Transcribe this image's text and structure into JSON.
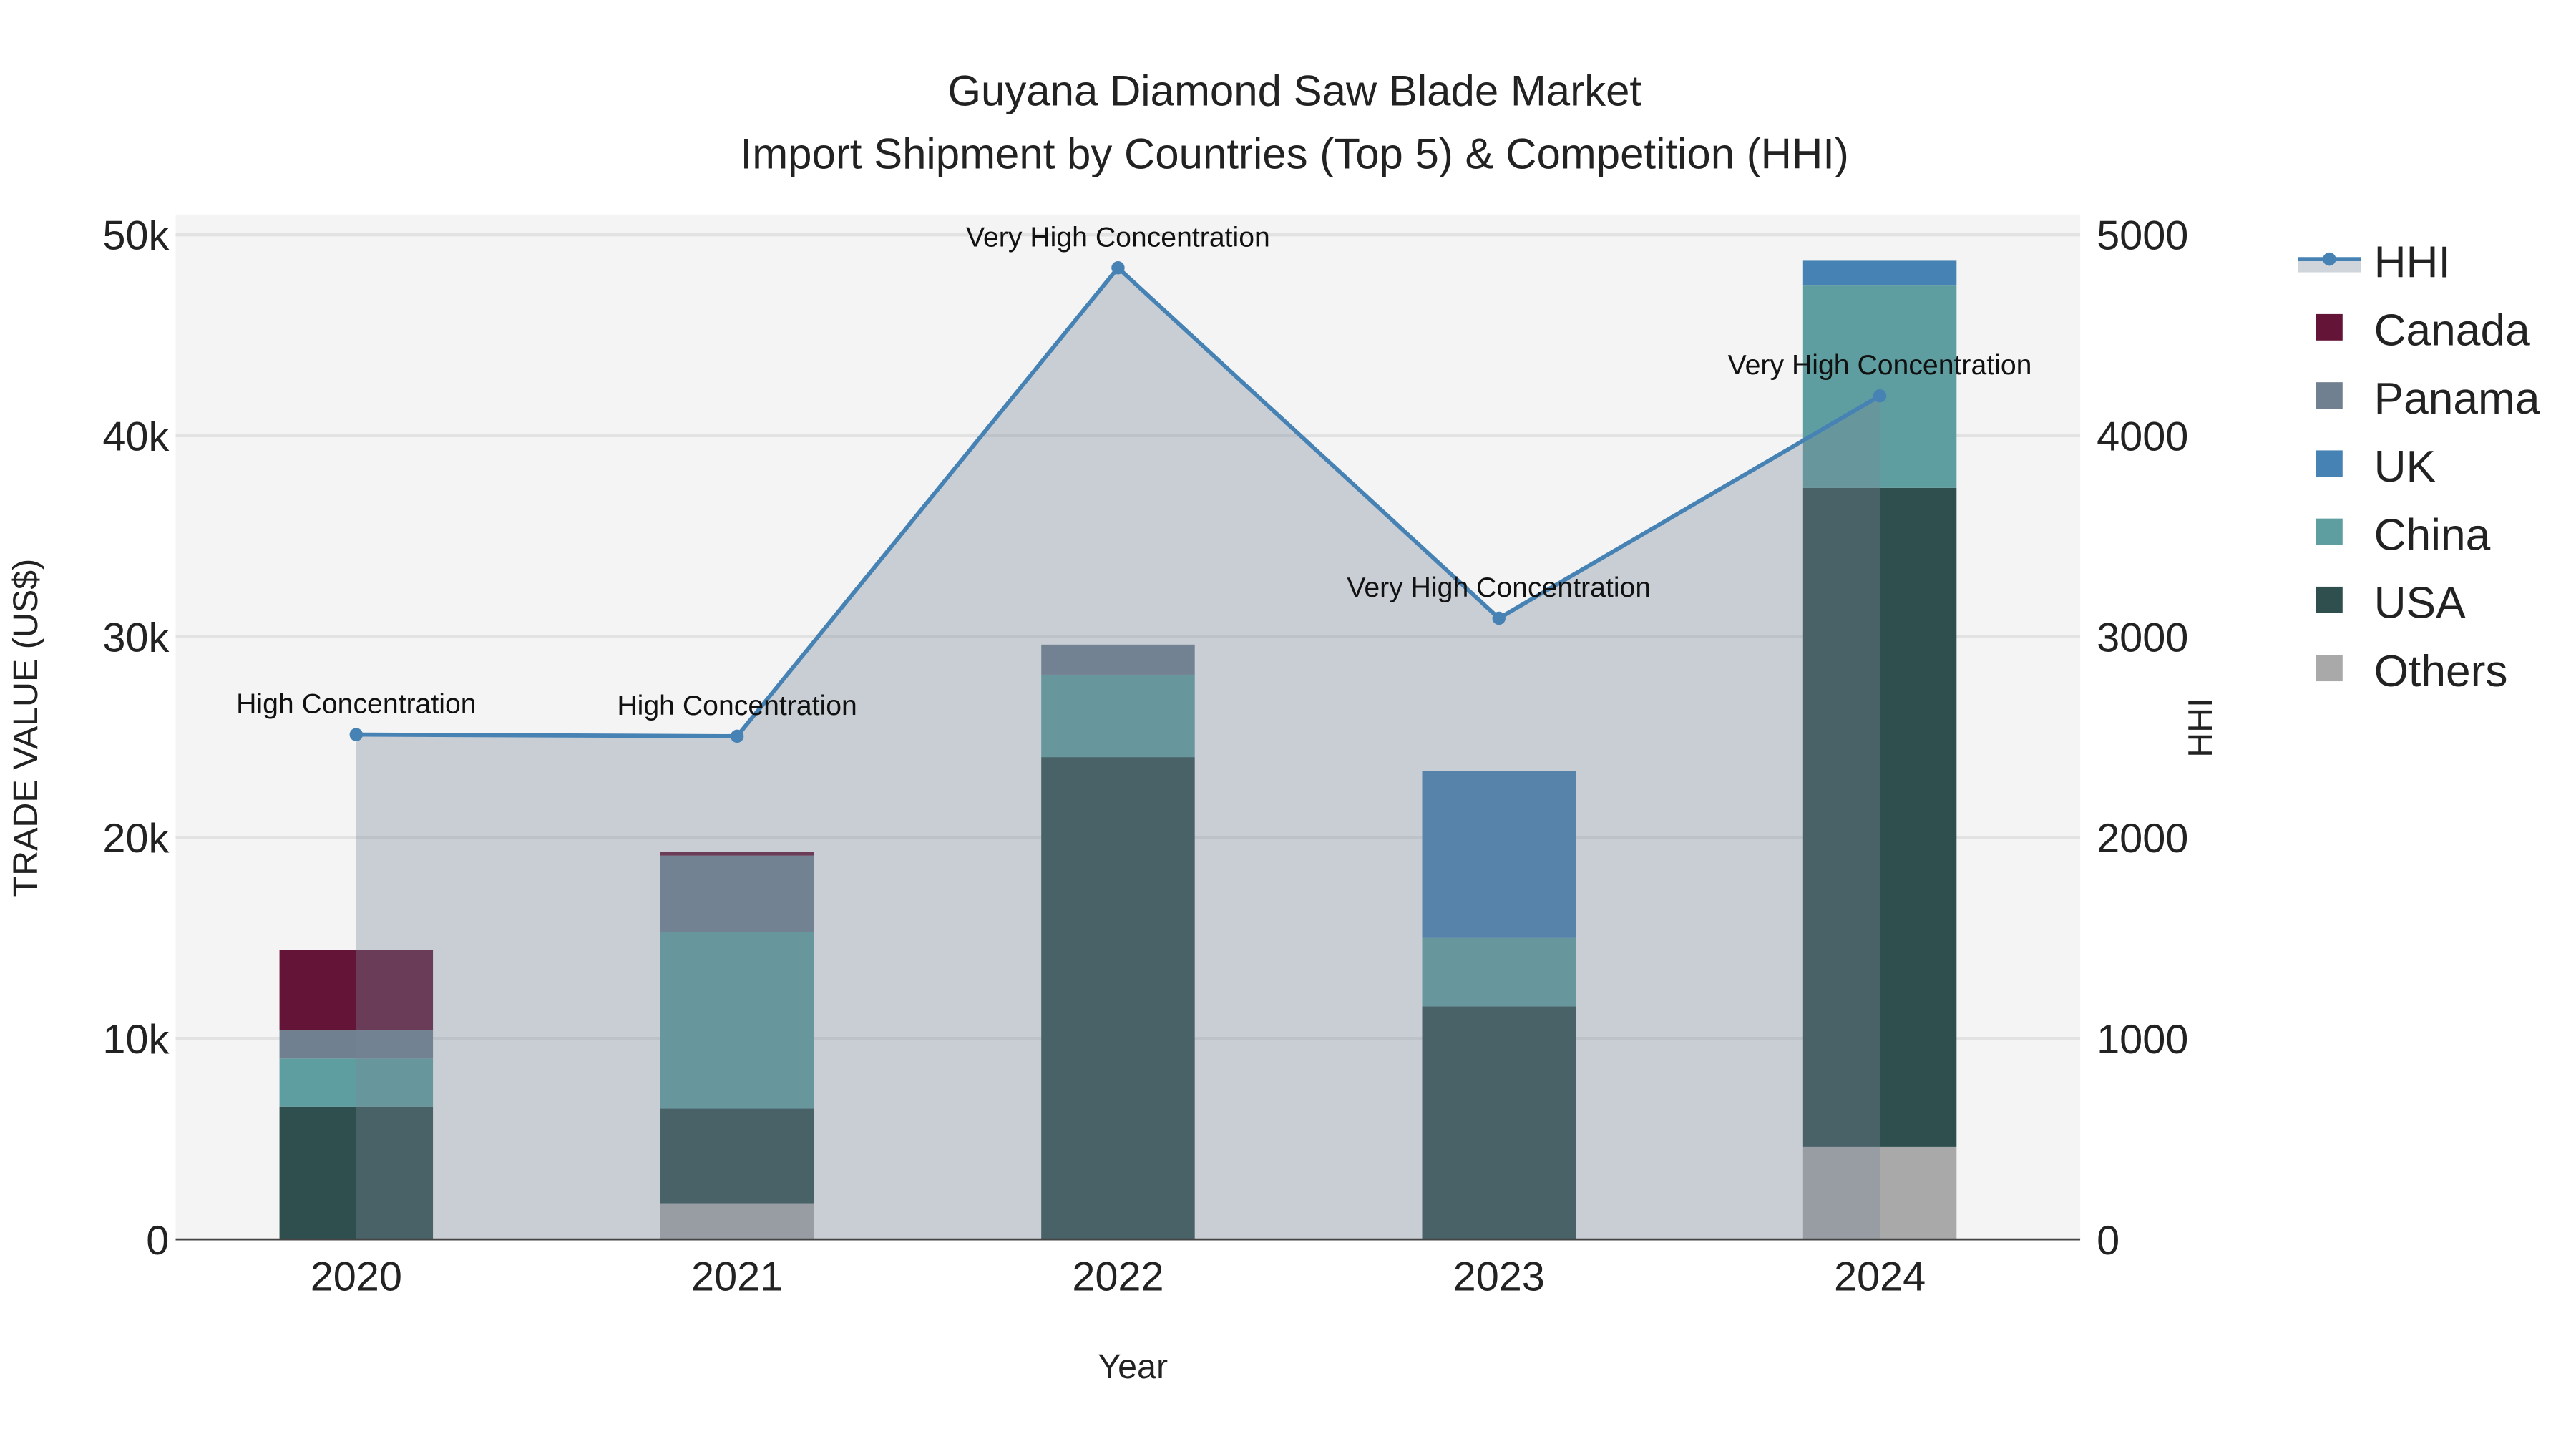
{
  "chart_data": {
    "type": "bar",
    "title": "Guyana Diamond Saw Blade Market",
    "subtitle": "Import Shipment by Countries (Top 5) & Competition (HHI)",
    "xlabel": "Year",
    "ylabel": "TRADE VALUE (US$)",
    "y2label": "HHI",
    "categories": [
      "2020",
      "2021",
      "2022",
      "2023",
      "2024"
    ],
    "ylim": [
      0,
      51000
    ],
    "y2lim": [
      0,
      5100
    ],
    "yticks": [
      0,
      10000,
      20000,
      30000,
      40000,
      50000
    ],
    "ytick_labels": [
      "0",
      "10k",
      "20k",
      "30k",
      "40k",
      "50k"
    ],
    "y2ticks": [
      0,
      1000,
      2000,
      3000,
      4000,
      5000
    ],
    "y2tick_labels": [
      "0",
      "1000",
      "2000",
      "3000",
      "4000",
      "5000"
    ],
    "grid": true,
    "legend_position": "right",
    "stacked": true,
    "series": [
      {
        "name": "Others",
        "color": "#a9a9a9",
        "values": [
          0,
          1800,
          0,
          0,
          4600
        ]
      },
      {
        "name": "USA",
        "color": "#2f4f4f",
        "values": [
          6600,
          4700,
          24000,
          11600,
          32800
        ]
      },
      {
        "name": "China",
        "color": "#5f9ea0",
        "values": [
          2400,
          8800,
          4100,
          3400,
          10100
        ]
      },
      {
        "name": "UK",
        "color": "#4682b4",
        "values": [
          0,
          0,
          0,
          8300,
          1200
        ]
      },
      {
        "name": "Panama",
        "color": "#708090",
        "values": [
          1400,
          3800,
          1500,
          0,
          0
        ]
      },
      {
        "name": "Canada",
        "color": "#641537",
        "values": [
          4000,
          200,
          0,
          0,
          0
        ]
      }
    ],
    "hhi": {
      "name": "HHI",
      "color": "#4682b4",
      "values": [
        2512,
        2504,
        4835,
        3091,
        4198
      ],
      "labels": [
        "High Concentration",
        "High Concentration",
        "Very High Concentration",
        "Very High Concentration",
        "Very High Concentration"
      ]
    },
    "legend_order": [
      "HHI",
      "Canada",
      "Panama",
      "UK",
      "China",
      "USA",
      "Others"
    ]
  }
}
